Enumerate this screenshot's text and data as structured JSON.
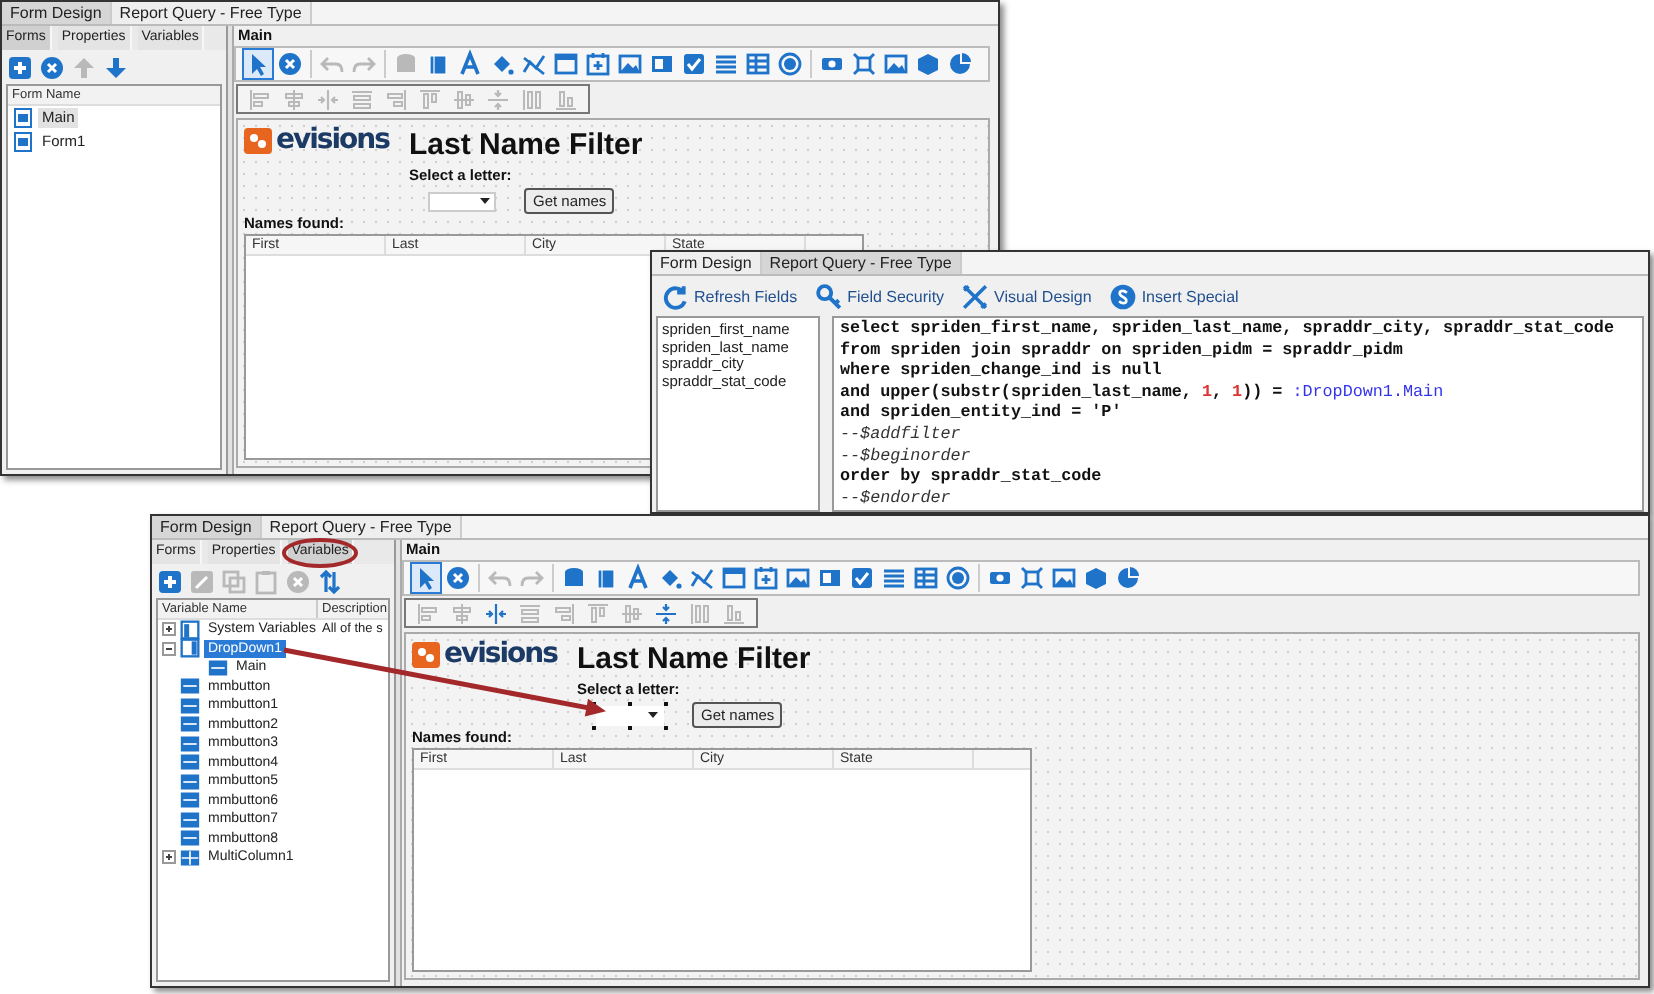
{
  "windows": [
    {
      "kind": "form_design",
      "tabs": [
        {
          "label": "Form Design",
          "selected": true
        },
        {
          "label": "Report Query - Free Type",
          "selected": false
        }
      ],
      "side_tabs": [
        {
          "label": "Forms",
          "selected": true
        },
        {
          "label": "Properties",
          "selected": false
        },
        {
          "label": "Variables",
          "selected": false
        }
      ],
      "side_toolbar": [
        {
          "kind": "add",
          "disabled": false
        },
        {
          "kind": "delete",
          "disabled": false
        },
        {
          "kind": "up",
          "disabled": true
        },
        {
          "kind": "down",
          "disabled": false
        }
      ],
      "form_list": {
        "header": "Form Name",
        "items": [
          {
            "label": "Main",
            "selected": true
          },
          {
            "label": "Form1",
            "selected": false
          }
        ]
      },
      "panel_title": "Main",
      "toolbar": [
        [
          {
            "kind": "pointer",
            "selected": true,
            "disabled": false
          },
          {
            "kind": "cancel",
            "selected": false,
            "disabled": false
          }
        ],
        [
          {
            "kind": "undo",
            "selected": false,
            "disabled": true
          },
          {
            "kind": "redo",
            "selected": false,
            "disabled": true
          }
        ],
        [
          {
            "kind": "database",
            "selected": false,
            "disabled": true
          },
          {
            "kind": "book",
            "selected": false,
            "disabled": false
          },
          {
            "kind": "font",
            "selected": false,
            "disabled": false
          },
          {
            "kind": "fill",
            "selected": false,
            "disabled": false
          },
          {
            "kind": "chart",
            "selected": false,
            "disabled": false
          },
          {
            "kind": "window",
            "selected": false,
            "disabled": false
          },
          {
            "kind": "calendar",
            "selected": false,
            "disabled": false
          },
          {
            "kind": "image",
            "selected": false,
            "disabled": false
          },
          {
            "kind": "panel",
            "selected": false,
            "disabled": false
          },
          {
            "kind": "checkbox",
            "selected": false,
            "disabled": false
          },
          {
            "kind": "list",
            "selected": false,
            "disabled": false
          },
          {
            "kind": "table",
            "selected": false,
            "disabled": false
          },
          {
            "kind": "radio",
            "selected": false,
            "disabled": false
          }
        ],
        [
          {
            "kind": "link",
            "selected": false,
            "disabled": false
          },
          {
            "kind": "crop",
            "selected": false,
            "disabled": false
          },
          {
            "kind": "picture",
            "selected": false,
            "disabled": false
          },
          {
            "kind": "cube",
            "selected": false,
            "disabled": false
          },
          {
            "kind": "pie",
            "selected": false,
            "disabled": false
          }
        ]
      ],
      "align_toolbar": [
        {
          "kind": "left",
          "disabled": true
        },
        {
          "kind": "center",
          "disabled": true
        },
        {
          "kind": "hcenter",
          "disabled": true
        },
        {
          "kind": "width",
          "disabled": true
        },
        {
          "kind": "right",
          "disabled": true
        },
        {
          "kind": "top",
          "disabled": true
        },
        {
          "kind": "middle",
          "disabled": true
        },
        {
          "kind": "vcenter",
          "disabled": true
        },
        {
          "kind": "height",
          "disabled": true
        },
        {
          "kind": "bottom",
          "disabled": true
        }
      ],
      "canvas": {
        "logo": "evisions",
        "title": "Last Name Filter",
        "prompt": "Select a letter:",
        "dropdown_selected": false,
        "button": "Get names",
        "results_label": "Names found:",
        "columns": [
          "First",
          "Last",
          "City",
          "State"
        ]
      }
    },
    {
      "kind": "query",
      "tabs": [
        {
          "label": "Form Design",
          "selected": false
        },
        {
          "label": "Report Query - Free Type",
          "selected": true
        }
      ],
      "actions": [
        {
          "kind": "refresh",
          "label": "Refresh Fields"
        },
        {
          "kind": "security",
          "label": "Field Security"
        },
        {
          "kind": "visual",
          "label": "Visual Design"
        },
        {
          "kind": "special",
          "label": "Insert Special"
        }
      ],
      "fields": [
        "spriden_first_name",
        "spriden_last_name",
        "spraddr_city",
        "spraddr_stat_code"
      ],
      "sql": [
        [
          {
            "kind": "code",
            "text": "select spriden_first_name, spriden_last_name, spraddr_city, spraddr_stat_code"
          }
        ],
        [
          {
            "kind": "code",
            "text": "from spriden join spraddr on spriden_pidm = spraddr_pidm"
          }
        ],
        [
          {
            "kind": "code",
            "text": "where spriden_change_ind is null"
          }
        ],
        [
          {
            "kind": "code",
            "text": "and upper(substr(spriden_last_name, "
          },
          {
            "kind": "number",
            "text": "1"
          },
          {
            "kind": "code",
            "text": ", "
          },
          {
            "kind": "number",
            "text": "1"
          },
          {
            "kind": "code",
            "text": ")) = "
          },
          {
            "kind": "param",
            "text": ":DropDown1.Main"
          }
        ],
        [
          {
            "kind": "code",
            "text": "and spriden_entity_ind = 'P'"
          }
        ],
        [
          {
            "kind": "comment",
            "text": "--$addfilter"
          }
        ],
        [
          {
            "kind": "comment",
            "text": "--$beginorder"
          }
        ],
        [
          {
            "kind": "code",
            "text": "order by spraddr_stat_code"
          }
        ],
        [
          {
            "kind": "comment",
            "text": "--$endorder"
          }
        ]
      ]
    },
    {
      "kind": "form_design",
      "tabs": [
        {
          "label": "Form Design",
          "selected": true
        },
        {
          "label": "Report Query - Free Type",
          "selected": false
        }
      ],
      "side_tabs": [
        {
          "label": "Forms",
          "selected": false,
          "highlighted": false
        },
        {
          "label": "Properties",
          "selected": false,
          "highlighted": false
        },
        {
          "label": "Variables",
          "selected": true,
          "highlighted": true
        }
      ],
      "side_toolbar": [
        {
          "kind": "add",
          "disabled": false
        },
        {
          "kind": "edit",
          "disabled": true
        },
        {
          "kind": "copy",
          "disabled": true
        },
        {
          "kind": "paste",
          "disabled": true
        },
        {
          "kind": "delete",
          "disabled": true
        },
        {
          "kind": "sort",
          "disabled": false
        }
      ],
      "variable_tree": {
        "columns": [
          "Variable Name",
          "Description"
        ],
        "items": [
          {
            "kind": "folder",
            "label": "System Variables",
            "description": "All of the s",
            "selected": false,
            "expanded": false
          },
          {
            "kind": "dropdown",
            "label": "DropDown1",
            "selected": true,
            "expanded": true,
            "children": [
              {
                "kind": "text",
                "label": "Main",
                "selected": false
              }
            ]
          },
          {
            "kind": "text",
            "label": "mmbutton",
            "selected": false
          },
          {
            "kind": "text",
            "label": "mmbutton1",
            "selected": false
          },
          {
            "kind": "text",
            "label": "mmbutton2",
            "selected": false
          },
          {
            "kind": "text",
            "label": "mmbutton3",
            "selected": false
          },
          {
            "kind": "text",
            "label": "mmbutton4",
            "selected": false
          },
          {
            "kind": "text",
            "label": "mmbutton5",
            "selected": false
          },
          {
            "kind": "text",
            "label": "mmbutton6",
            "selected": false
          },
          {
            "kind": "text",
            "label": "mmbutton7",
            "selected": false
          },
          {
            "kind": "text",
            "label": "mmbutton8",
            "selected": false
          },
          {
            "kind": "grid",
            "label": "MultiColumn1",
            "selected": false,
            "expanded": false
          }
        ]
      },
      "panel_title": "Main",
      "toolbar": [
        [
          {
            "kind": "pointer",
            "selected": true,
            "disabled": false
          },
          {
            "kind": "cancel",
            "selected": false,
            "disabled": false
          }
        ],
        [
          {
            "kind": "undo",
            "selected": false,
            "disabled": true
          },
          {
            "kind": "redo",
            "selected": false,
            "disabled": true
          }
        ],
        [
          {
            "kind": "database",
            "selected": false,
            "disabled": false
          },
          {
            "kind": "book",
            "selected": false,
            "disabled": false
          },
          {
            "kind": "font",
            "selected": false,
            "disabled": false
          },
          {
            "kind": "fill",
            "selected": false,
            "disabled": false
          },
          {
            "kind": "chart",
            "selected": false,
            "disabled": false
          },
          {
            "kind": "window",
            "selected": false,
            "disabled": false
          },
          {
            "kind": "calendar",
            "selected": false,
            "disabled": false
          },
          {
            "kind": "image",
            "selected": false,
            "disabled": false
          },
          {
            "kind": "panel",
            "selected": false,
            "disabled": false
          },
          {
            "kind": "checkbox",
            "selected": false,
            "disabled": false
          },
          {
            "kind": "list",
            "selected": false,
            "disabled": false
          },
          {
            "kind": "table",
            "selected": false,
            "disabled": false
          },
          {
            "kind": "radio",
            "selected": false,
            "disabled": false
          }
        ],
        [
          {
            "kind": "link",
            "selected": false,
            "disabled": false
          },
          {
            "kind": "crop",
            "selected": false,
            "disabled": false
          },
          {
            "kind": "picture",
            "selected": false,
            "disabled": false
          },
          {
            "kind": "cube",
            "selected": false,
            "disabled": false
          },
          {
            "kind": "pie",
            "selected": false,
            "disabled": false
          }
        ]
      ],
      "align_toolbar": [
        {
          "kind": "left",
          "disabled": true
        },
        {
          "kind": "center",
          "disabled": true
        },
        {
          "kind": "hcenter",
          "disabled": false
        },
        {
          "kind": "width",
          "disabled": true
        },
        {
          "kind": "right",
          "disabled": true
        },
        {
          "kind": "top",
          "disabled": true
        },
        {
          "kind": "middle",
          "disabled": true
        },
        {
          "kind": "vcenter",
          "disabled": false
        },
        {
          "kind": "height",
          "disabled": true
        },
        {
          "kind": "bottom",
          "disabled": true
        }
      ],
      "canvas": {
        "logo": "evisions",
        "title": "Last Name Filter",
        "prompt": "Select a letter:",
        "dropdown_selected": true,
        "button": "Get names",
        "results_label": "Names found:",
        "columns": [
          "First",
          "Last",
          "City",
          "State"
        ]
      }
    }
  ],
  "annotations": {
    "arrow": true
  }
}
